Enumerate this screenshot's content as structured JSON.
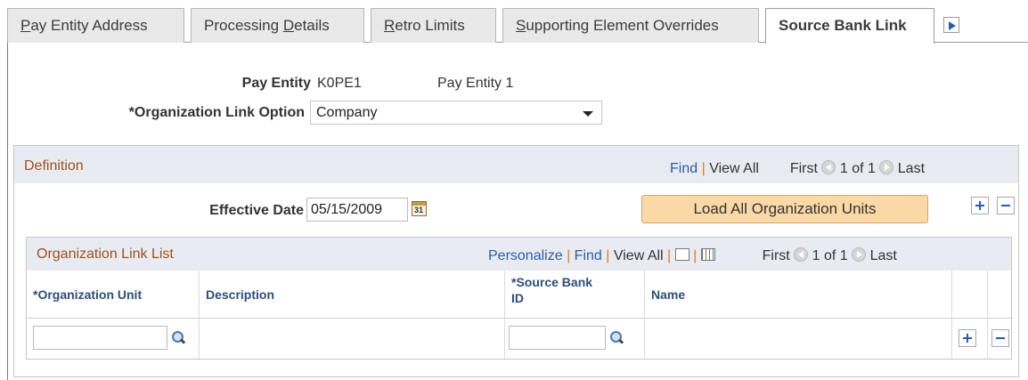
{
  "tabs": [
    {
      "label": "Pay Entity Address",
      "accel": "P",
      "rest": "ay Entity Address"
    },
    {
      "label": "Processing Details",
      "before": "Processing ",
      "accel": "D",
      "rest": "etails"
    },
    {
      "label": "Retro Limits",
      "accel": "R",
      "rest": "etro Limits"
    },
    {
      "label": "Supporting Element Overrides",
      "accel": "S",
      "rest": "upporting Element Overrides"
    },
    {
      "label": "Source Bank Link",
      "active": true
    }
  ],
  "header": {
    "pay_entity_label": "Pay Entity",
    "pay_entity_code": "K0PE1",
    "pay_entity_name": "Pay Entity 1",
    "org_link_label": "*Organization Link Option",
    "org_link_value": "Company"
  },
  "definition": {
    "title": "Definition",
    "find": "Find",
    "sep": "|",
    "view_all": "View All",
    "first": "First",
    "count": "1 of 1",
    "last": "Last",
    "effective_date_label": "Effective Date",
    "effective_date_value": "05/15/2009",
    "calendar_glyph": "31",
    "load_button": "Load All Organization Units"
  },
  "grid": {
    "title": "Organization Link List",
    "personalize": "Personalize",
    "find": "Find",
    "view_all": "View All",
    "sep": "|",
    "first": "First",
    "count": "1 of 1",
    "last": "Last",
    "columns": {
      "org_unit": "*Organization Unit",
      "description": "Description",
      "source_bank_id_1": "*Source Bank",
      "source_bank_id_2": "ID",
      "name": "Name"
    },
    "row": {
      "org_unit": "",
      "description": "",
      "source_bank_id": "",
      "name": ""
    }
  },
  "colors": {
    "link": "#2a5ca8",
    "group_title": "#a0501e",
    "button": "#fbd9a6",
    "header_bg": "#e8ecf2"
  }
}
